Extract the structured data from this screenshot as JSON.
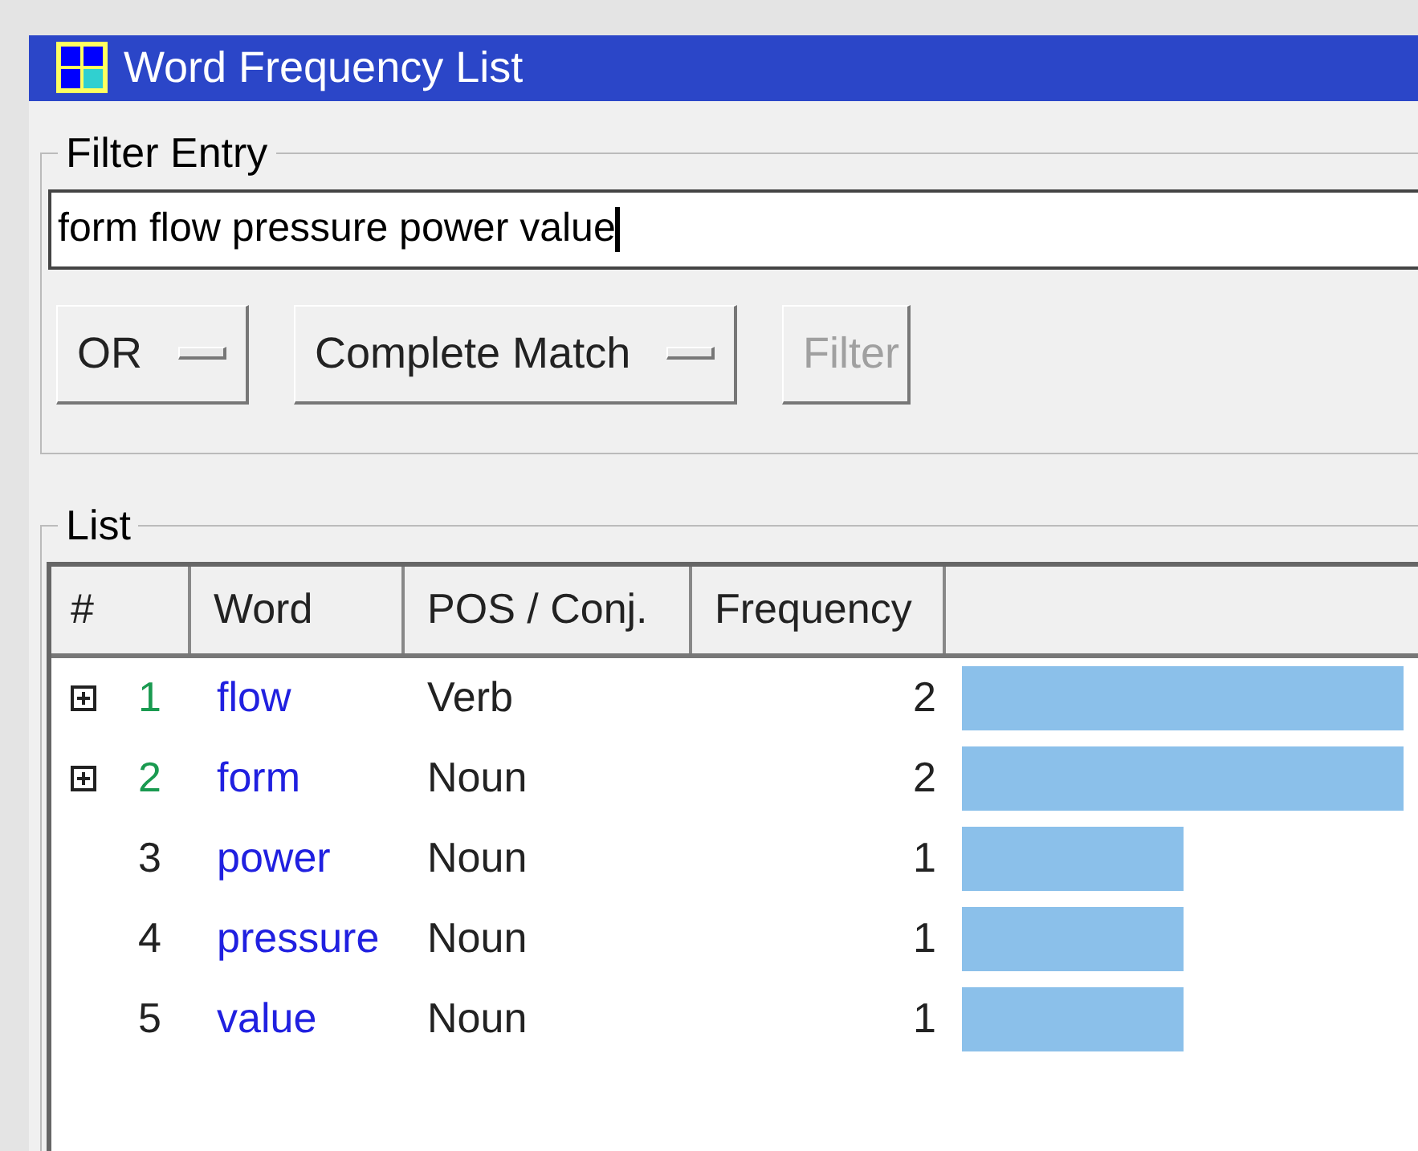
{
  "window": {
    "title": "Word Frequency List"
  },
  "filter_entry": {
    "legend": "Filter Entry",
    "query": "form flow pressure power value",
    "buttons": [
      {
        "label": "OR",
        "kind": "menu",
        "disabled": false
      },
      {
        "label": "Complete Match",
        "kind": "menu",
        "disabled": false
      },
      {
        "label": "Filter",
        "kind": "push",
        "disabled": true
      }
    ]
  },
  "list": {
    "legend": "List",
    "columns": [
      "#",
      "Word",
      "POS / Conj.",
      "Frequency"
    ],
    "rows": [
      {
        "kind": "group",
        "expanded": false,
        "number": "1",
        "word": "flow",
        "pos": "Verb",
        "frequency": "2"
      },
      {
        "kind": "group",
        "expanded": false,
        "number": "2",
        "word": "form",
        "pos": "Noun",
        "frequency": "2"
      },
      {
        "kind": "word",
        "number": "3",
        "word": "power",
        "pos": "Noun",
        "frequency": "1"
      },
      {
        "kind": "word",
        "number": "4",
        "word": "pressure",
        "pos": "Noun",
        "frequency": "1"
      },
      {
        "kind": "word",
        "number": "5",
        "word": "value",
        "pos": "Noun",
        "frequency": "1"
      }
    ]
  }
}
